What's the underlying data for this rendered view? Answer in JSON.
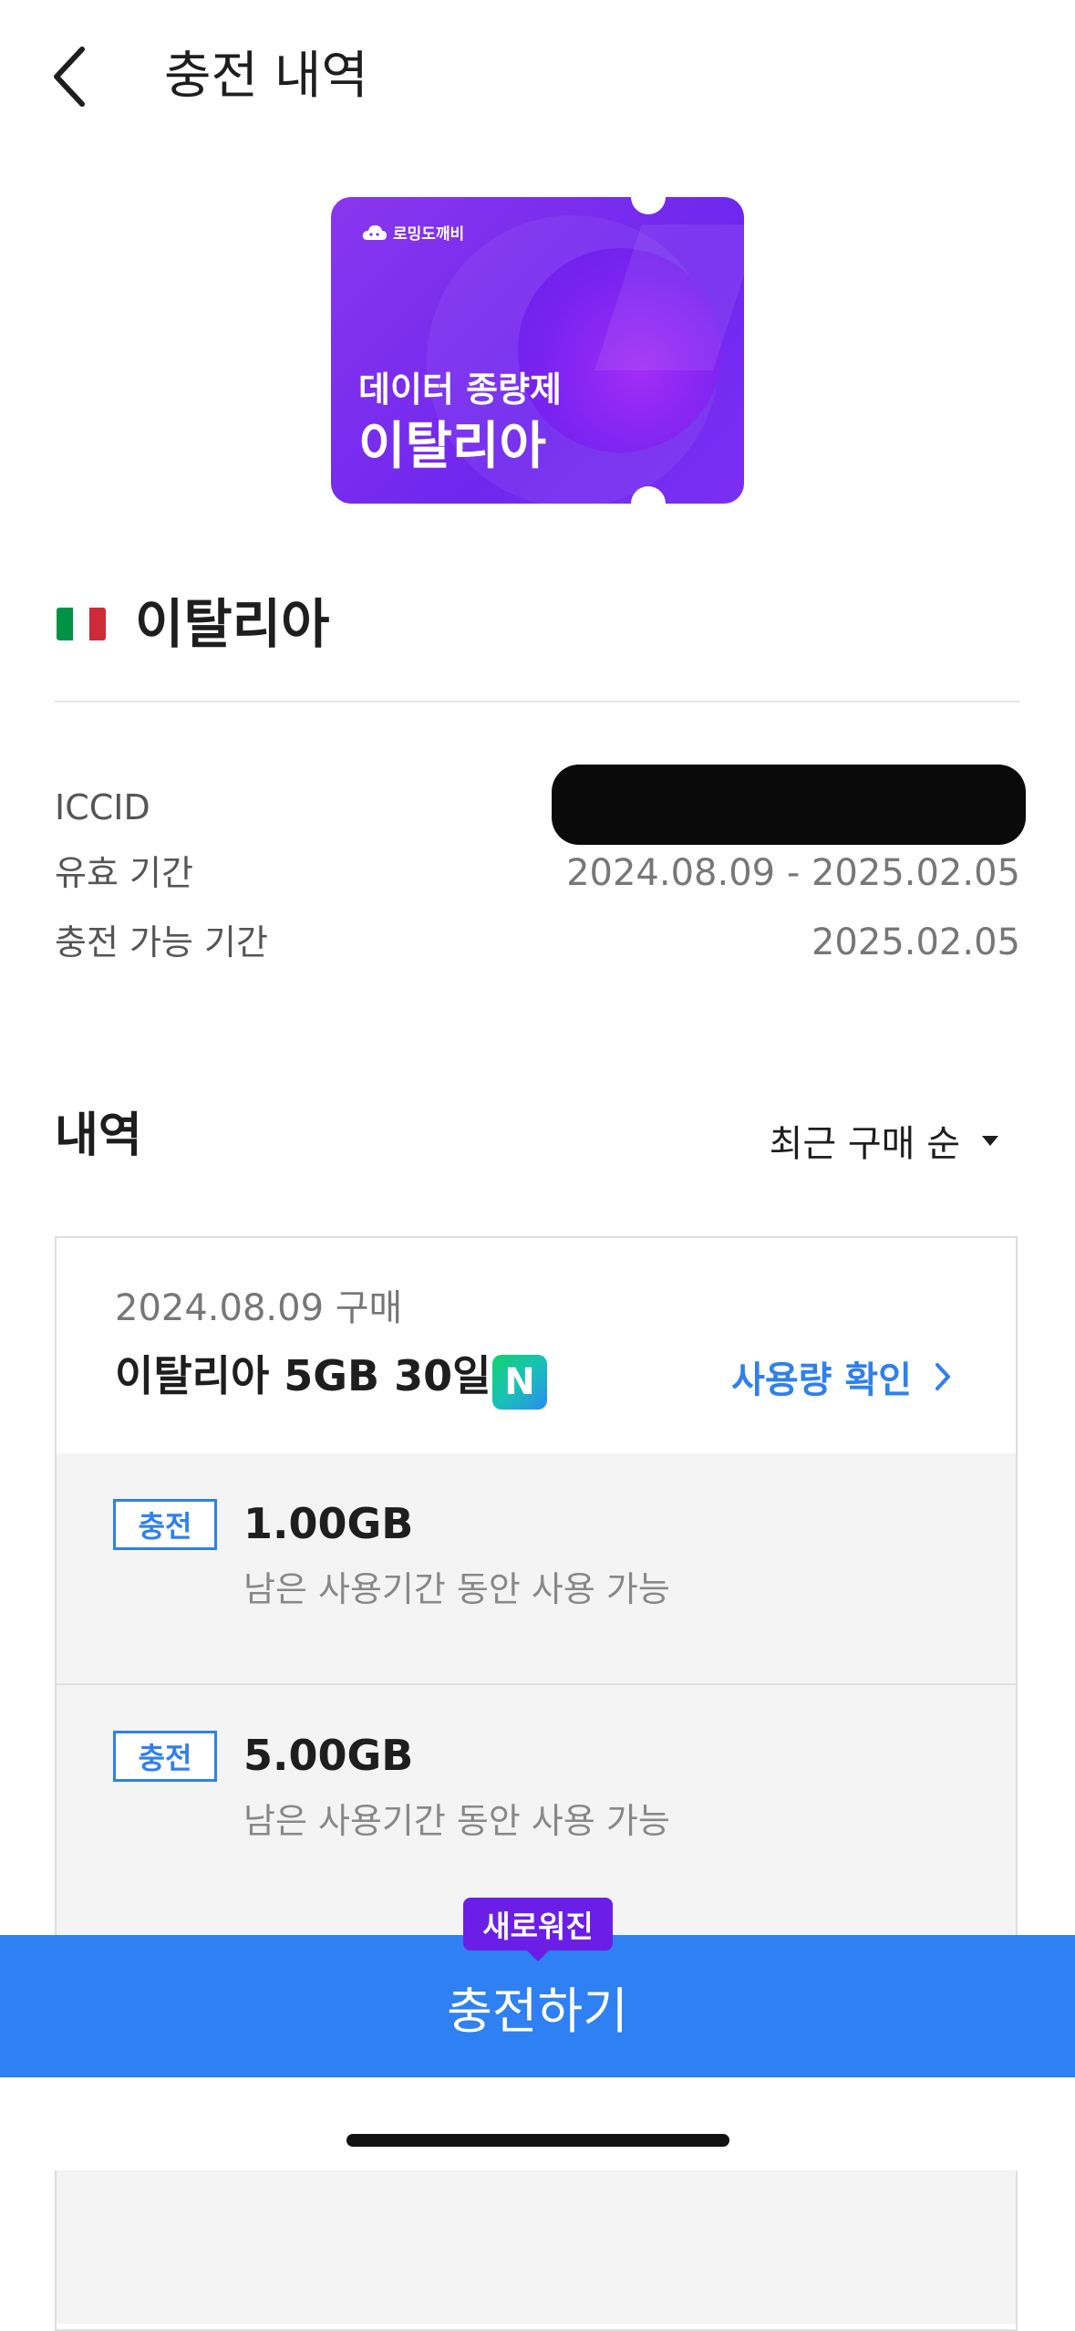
{
  "header": {
    "title": "충전 내역",
    "back_icon": "chevron-left-icon"
  },
  "card": {
    "brand": "로밍도깨비",
    "product": "데이터 종량제",
    "country": "이탈리아",
    "colors": {
      "primary": "#7a2ff3",
      "accent": "#a22cf6"
    }
  },
  "country": {
    "name": "이탈리아",
    "flag": "italy-flag",
    "flag_colors": [
      "#009246",
      "#ffffff",
      "#ce2b37"
    ]
  },
  "info": {
    "iccid_label": "ICCID",
    "validity_label": "유효 기간",
    "validity_value": "2024.08.09 - 2025.02.05",
    "charge_period_label": "충전 가능 기간",
    "charge_period_value": "2025.02.05"
  },
  "history": {
    "title": "내역",
    "sort": {
      "selected": "최근 구매 순",
      "icon": "caret-down-icon"
    },
    "purchase": {
      "date": "2024.08.09 구매",
      "plan": "이탈리아 5GB 30일",
      "badge": "N",
      "usage_link": "사용량 확인"
    },
    "charges": [
      {
        "badge": "충전",
        "amount": "1.00GB",
        "desc": "남은 사용기간 동안 사용 가능"
      },
      {
        "badge": "충전",
        "amount": "5.00GB",
        "desc": "남은 사용기간 동안 사용 가능"
      }
    ]
  },
  "cta": {
    "label": "충전하기",
    "new_badge": "새로워진",
    "color": "#2f80f2"
  }
}
